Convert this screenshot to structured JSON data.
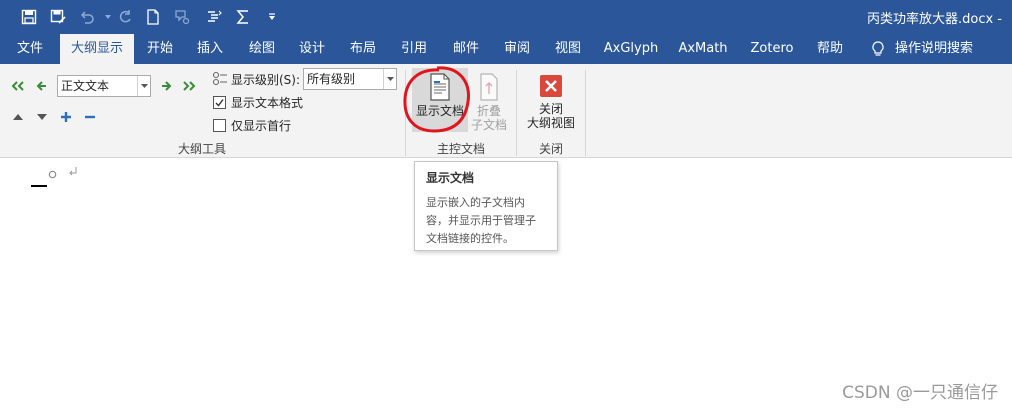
{
  "title_bar": {
    "document_title": "丙类功率放大器.docx  -",
    "quick_access": [
      {
        "icon": "save-icon"
      },
      {
        "icon": "save-as-icon"
      },
      {
        "icon": "undo-icon"
      },
      {
        "icon": "redo-icon"
      },
      {
        "icon": "new-document-icon"
      },
      {
        "icon": "touch-mode-icon"
      },
      {
        "icon": "outline-icon"
      },
      {
        "icon": "equation-icon"
      },
      {
        "icon": "customize-qat-icon"
      }
    ]
  },
  "tabs": {
    "file": "文件",
    "outline": "大纲显示",
    "home": "开始",
    "insert": "插入",
    "draw": "绘图",
    "design": "设计",
    "layout": "布局",
    "references": "引用",
    "mailings": "邮件",
    "review": "审阅",
    "view": "视图",
    "axglyph": "AxGlyph",
    "axmath": "AxMath",
    "zotero": "Zotero",
    "help": "帮助",
    "tell_me": "操作说明搜索",
    "active": "outline"
  },
  "outline_tools": {
    "level_combo": "正文文本",
    "show_level_label": "显示级别(S):",
    "show_level_value": "所有级别",
    "show_text_formatting": "显示文本格式",
    "show_text_formatting_checked": true,
    "show_first_line_only": "仅显示首行",
    "show_first_line_only_checked": false,
    "group_label": "大纲工具"
  },
  "master_document": {
    "show_document": "显示文档",
    "collapse_subdocs_line1": "折叠",
    "collapse_subdocs_line2": "子文档",
    "group_label": "主控文档"
  },
  "close_group": {
    "close_line1": "关闭",
    "close_line2": "大纲视图",
    "group_label": "关闭"
  },
  "tooltip": {
    "title": "显示文档",
    "body": "显示嵌入的子文档内容，并显示用于管理子文档链接的控件。"
  },
  "watermark": "CSDN @一只通信仔",
  "colors": {
    "ribbon_blue": "#2b579a",
    "ribbon_bg": "#f3f3f3",
    "annotation_red": "#e0161f",
    "close_red": "#d9483b"
  }
}
